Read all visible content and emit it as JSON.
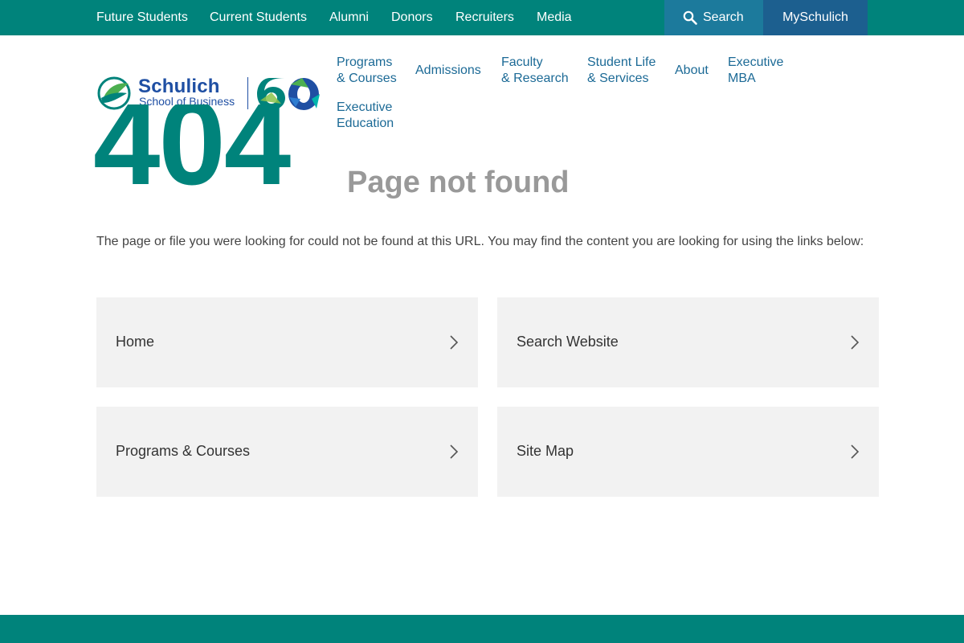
{
  "utility_nav": {
    "links": [
      "Future Students",
      "Current Students",
      "Alumni",
      "Donors",
      "Recruiters",
      "Media"
    ],
    "search_label": "Search",
    "myschulich_label": "MySchulich"
  },
  "logo": {
    "name": "Schulich",
    "subtitle": "School of Business",
    "anniversary": "60"
  },
  "main_nav": {
    "programs": [
      "Programs",
      "& Courses"
    ],
    "admissions": "Admissions",
    "faculty": [
      "Faculty",
      "& Research"
    ],
    "student_life": [
      "Student Life",
      "& Services"
    ],
    "about": "About",
    "executive_mba": [
      "Executive",
      "MBA"
    ],
    "executive_education": [
      "Executive",
      "Education"
    ]
  },
  "error": {
    "code": "404",
    "title": "Page not found",
    "message": "The page or file you were looking for could not be found at this URL. You may find the content you are looking for using the links below:"
  },
  "cards": [
    {
      "label": "Home"
    },
    {
      "label": "Search Website"
    },
    {
      "label": "Programs & Courses"
    },
    {
      "label": "Site Map"
    }
  ],
  "colors": {
    "brand_teal": "#00837b",
    "search_blue": "#1c7a9c",
    "myschulich_blue": "#1c5f8f",
    "nav_link": "#1c6a96",
    "logo_blue": "#1f4fa3",
    "title_gray": "#999999",
    "card_bg": "#f2f2f2"
  },
  "icons": {
    "search": "search-icon",
    "chevron": "chevron-right-icon",
    "leaf": "schulich-leaf-icon"
  }
}
